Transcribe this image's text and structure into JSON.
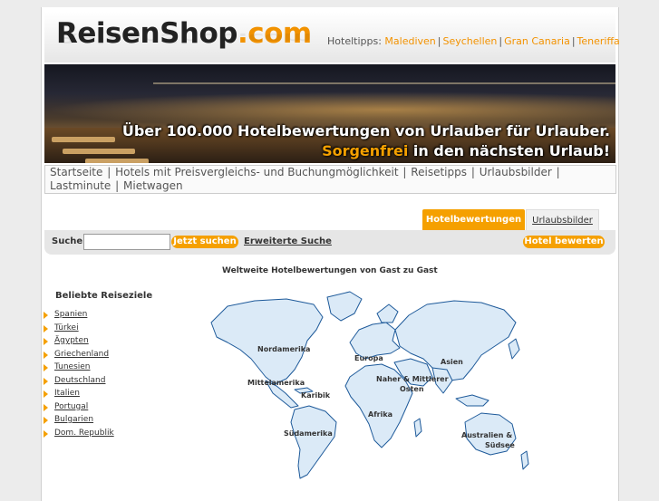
{
  "header": {
    "logo_part1": "ReisenShop",
    "logo_part2": ".com",
    "hoteltipps_label": "Hoteltipps:",
    "hoteltipps": [
      "Malediven",
      "Seychellen",
      "Gran Canaria",
      "Teneriffa"
    ]
  },
  "banner": {
    "line1": "Über 100.000 Hotelbewertungen von Urlauber für Urlauber.",
    "line2_highlight": "Sorgenfrei",
    "line2_rest": " in den nächsten Urlaub!"
  },
  "nav": [
    "Startseite",
    "Hotels mit Preisvergleichs- und Buchungmöglichkeit",
    "Reisetipps",
    "Urlaubsbilder",
    "Lastminute",
    "Mietwagen"
  ],
  "tabs": [
    {
      "label": "Hotelbewertungen",
      "active": true
    },
    {
      "label": "Urlaubsbilder",
      "active": false
    }
  ],
  "search": {
    "label": "Suche",
    "value": "",
    "button": "Jetzt suchen",
    "advanced": "Erweiterte Suche",
    "rate_button": "Hotel bewerten"
  },
  "map": {
    "title": "Weltweite Hotelbewertungen von Gast zu Gast",
    "regions": [
      "Nordamerika",
      "Mittelamerika",
      "Karibik",
      "Südamerika",
      "Europa",
      "Naher & Mittlerer",
      "Osten",
      "Afrika",
      "Asien",
      "Australien &",
      "Südsee"
    ]
  },
  "destinations": {
    "title": "Beliebte Reiseziele",
    "items": [
      "Spanien",
      "Türkei",
      "Ägypten",
      "Griechenland",
      "Tunesien",
      "Deutschland",
      "Italien",
      "Portugal",
      "Bulgarien",
      "Dom. Republik"
    ]
  },
  "colors": {
    "accent": "#f5a000",
    "map_fill": "#dbeaf7",
    "map_stroke": "#1e5a9a"
  }
}
